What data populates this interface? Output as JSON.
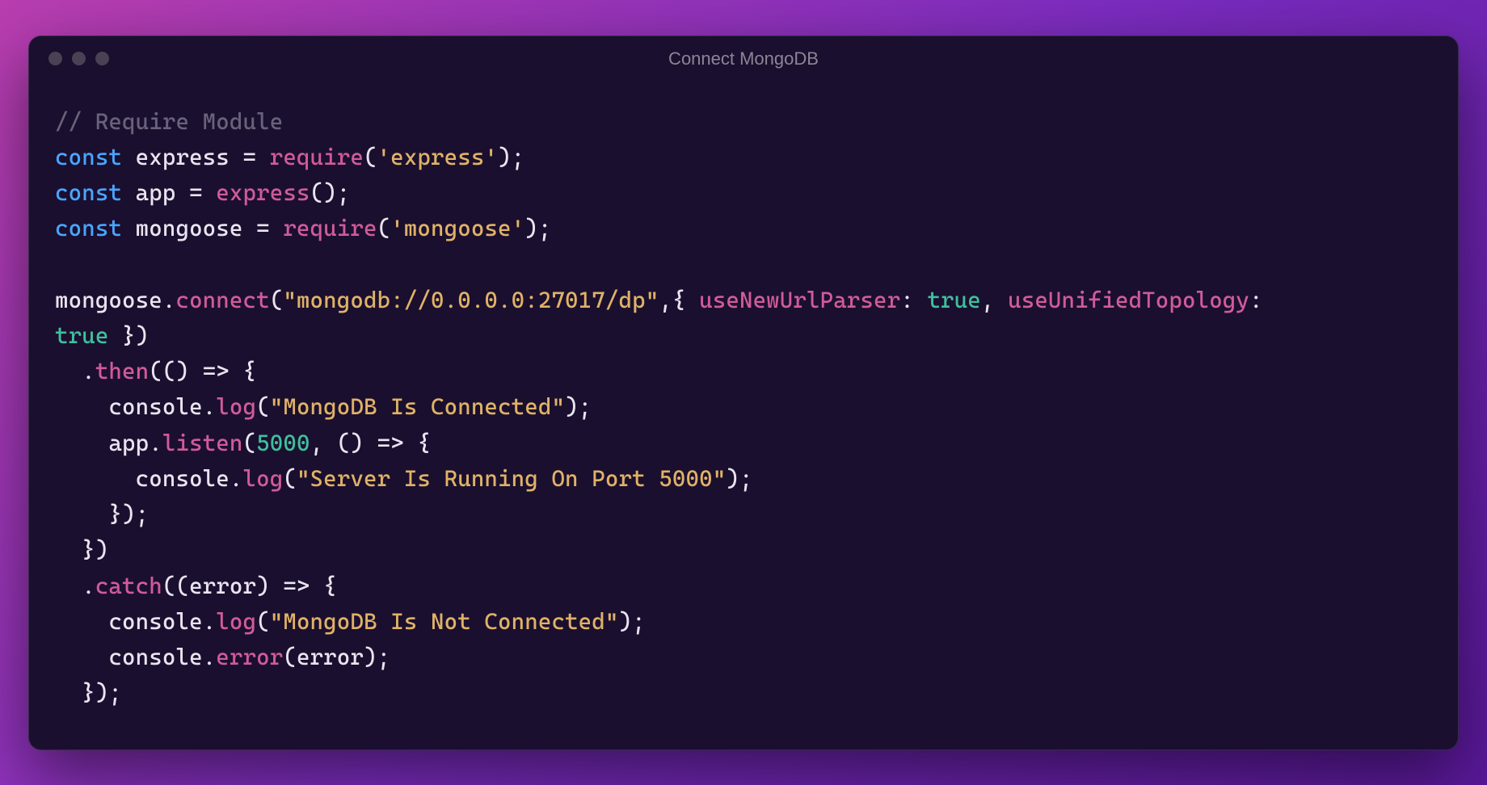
{
  "window": {
    "title": "Connect MongoDB"
  },
  "code": {
    "comment_require": "// Require Module",
    "kw_const": "const",
    "id_express": "express",
    "eq": " = ",
    "fn_require": "require",
    "str_express_mod": "'express'",
    "id_app": "app",
    "fn_express_call": "express",
    "id_mongoose": "mongoose",
    "str_mongoose_mod": "'mongoose'",
    "fn_connect": "connect",
    "str_mongo_uri": "\"mongodb://0.0.0.0:27017/dp\"",
    "prop_useNewUrlParser": "useNewUrlParser",
    "bool_true": "true",
    "prop_useUnifiedTopology": "useUnifiedTopology",
    "fn_then": "then",
    "arrow": " => ",
    "id_console": "console",
    "fn_log": "log",
    "str_connected": "\"MongoDB Is Connected\"",
    "fn_listen": "listen",
    "num_port": "5000",
    "str_server_running": "\"Server Is Running On Port 5000\"",
    "fn_catch": "catch",
    "id_error": "error",
    "str_not_connected": "\"MongoDB Is Not Connected\"",
    "fn_error": "error"
  }
}
